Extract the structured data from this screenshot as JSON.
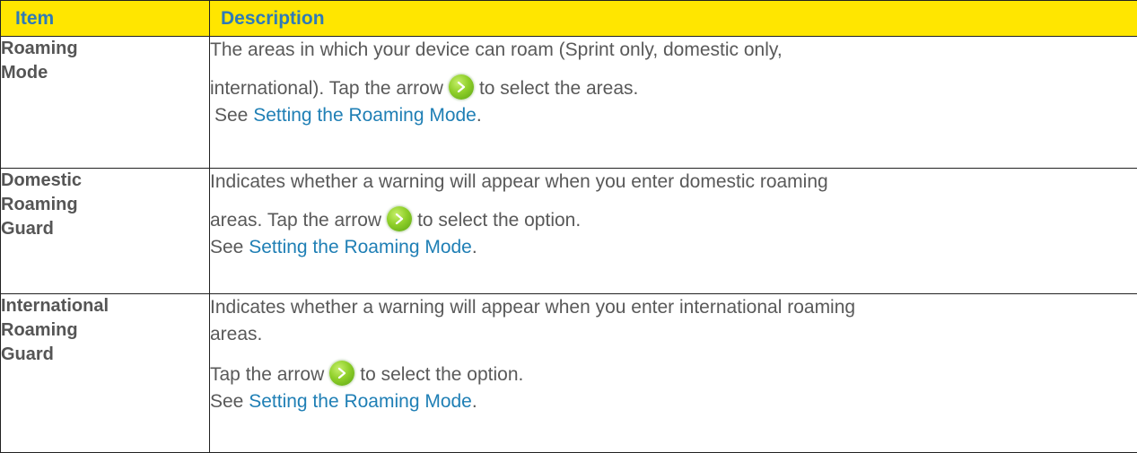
{
  "table": {
    "headers": {
      "item": "Item",
      "description": "Description"
    },
    "colors": {
      "header_background": "#ffe600",
      "header_text": "#2e7ab8",
      "link": "#1f7fb5",
      "body_text": "#595959"
    },
    "rows": [
      {
        "item_lines": [
          "Roaming",
          "Mode"
        ],
        "line1": "The areas in which your device can roam (Sprint only, domestic only,",
        "line2_before": "international). Tap the arrow",
        "line2_icon": "green-arrow-icon",
        "line2_after": "to select the areas.",
        "see_prefix": "See",
        "link_text": "Setting the Roaming Mode",
        "see_suffix": "."
      },
      {
        "item_lines": [
          "Domestic",
          "Roaming",
          "Guard"
        ],
        "line1": "Indicates whether a warning will appear when you enter domestic roaming",
        "line2_before": "areas. Tap the arrow",
        "line2_icon": "green-arrow-icon",
        "line2_after": "to select the option.",
        "see_prefix": "See",
        "link_text": "Setting the Roaming Mode",
        "see_suffix": "."
      },
      {
        "item_lines": [
          "International",
          "Roaming",
          "Guard"
        ],
        "line1": "Indicates whether a warning will appear when you enter international roaming",
        "line1b": "areas.",
        "line2_before": "Tap the arrow",
        "line2_icon": "green-arrow-icon",
        "line2_after": "to select the option.",
        "see_prefix": "See",
        "link_text": "Setting the Roaming Mode",
        "see_suffix": "."
      }
    ]
  }
}
